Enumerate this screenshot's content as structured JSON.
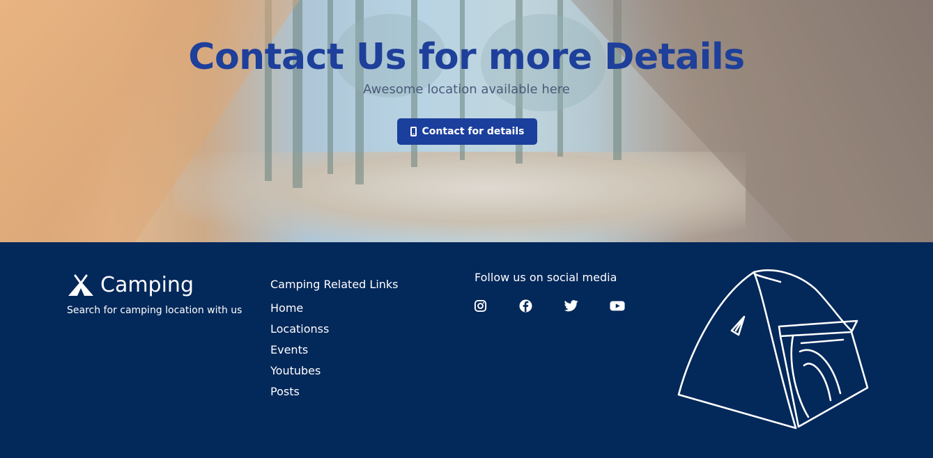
{
  "hero": {
    "title": "Contact Us for more Details",
    "subtitle": "Awesome location available here",
    "button_label": "Contact for details",
    "button_icon": "mobile-phone-icon"
  },
  "footer": {
    "brand": {
      "name": "Camping",
      "tagline": "Search for camping location with us",
      "icon": "tent-logo-icon"
    },
    "links_title": "Camping Related Links",
    "links": [
      "Home",
      "Locationss",
      "Events",
      "Youtubes",
      "Posts"
    ],
    "social_title": "Follow us on social media",
    "social": [
      "instagram-icon",
      "facebook-icon",
      "twitter-icon",
      "youtube-icon"
    ],
    "illustration": "tent-illustration"
  },
  "colors": {
    "primary": "#1b3f9c",
    "title": "#1e3f9a",
    "footer_bg": "#03285a",
    "text_light": "#ffffff"
  }
}
